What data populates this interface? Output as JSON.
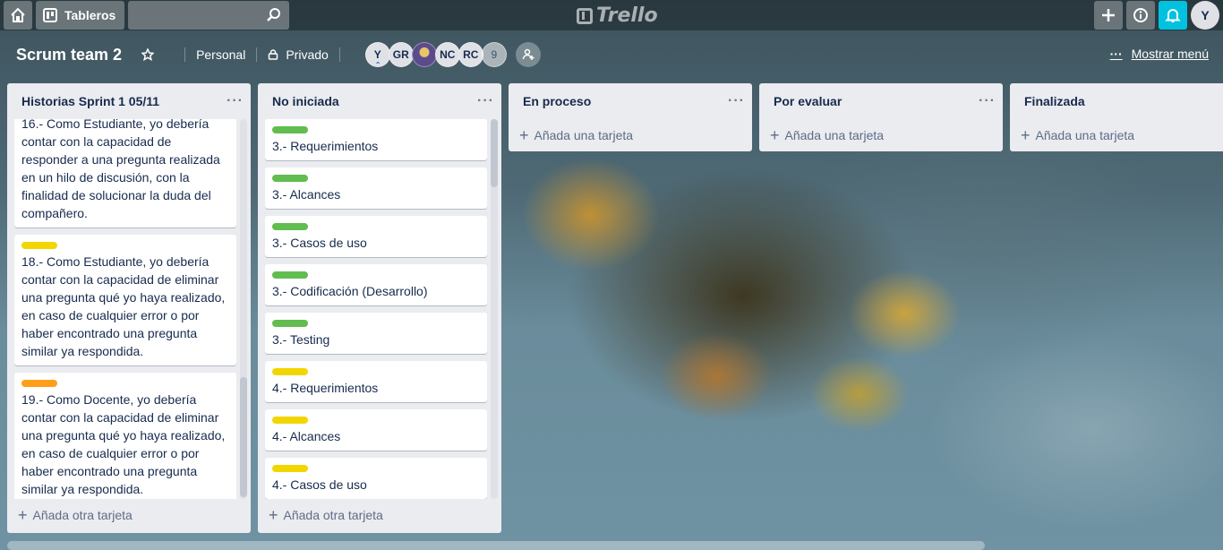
{
  "nav": {
    "boards_label": "Tableros",
    "logo_text": "Trello",
    "avatar_initial": "Y",
    "bell_color": "#00c2e0"
  },
  "board": {
    "title": "Scrum team 2",
    "team_label": "Personal",
    "visibility_label": "Privado",
    "members": [
      "Y",
      "GR",
      "",
      "NC",
      "RC"
    ],
    "member_more": "9",
    "show_menu_label": "Mostrar menú"
  },
  "lists": [
    {
      "title": "Historias Sprint 1 05/11",
      "cards": [
        {
          "label": "",
          "text": "16.- Como Estudiante, yo debería contar con la capacidad de responder a una pregunta realizada en un hilo de discusión, con la finalidad de solucionar la duda del compañero."
        },
        {
          "label": "yellow",
          "text": "18.- Como Estudiante, yo debería contar con la capacidad de eliminar una pregunta qué yo haya realizado, en caso de cualquier error o por haber encontrado una pregunta similar ya respondida."
        },
        {
          "label": "orange",
          "text": "19.- Como Docente, yo debería contar con la capacidad de eliminar una pregunta qué yo haya realizado, en caso de cualquier error o por haber encontrado una pregunta similar ya respondida."
        }
      ],
      "add_label": "Añada otra tarjeta"
    },
    {
      "title": "No iniciada",
      "cards": [
        {
          "label": "green",
          "text": "3.- Requerimientos"
        },
        {
          "label": "green",
          "text": "3.- Alcances"
        },
        {
          "label": "green",
          "text": "3.- Casos de uso"
        },
        {
          "label": "green",
          "text": "3.- Codificación (Desarrollo)"
        },
        {
          "label": "green",
          "text": "3.- Testing"
        },
        {
          "label": "yellow",
          "text": "4.- Requerimientos"
        },
        {
          "label": "yellow",
          "text": "4.- Alcances"
        },
        {
          "label": "yellow",
          "text": "4.- Casos de uso"
        }
      ],
      "add_label": "Añada otra tarjeta"
    },
    {
      "title": "En proceso",
      "add_label": "Añada una tarjeta"
    },
    {
      "title": "Por evaluar",
      "add_label": "Añada una tarjeta"
    },
    {
      "title": "Finalizada",
      "add_label": "Añada una tarjeta"
    }
  ]
}
